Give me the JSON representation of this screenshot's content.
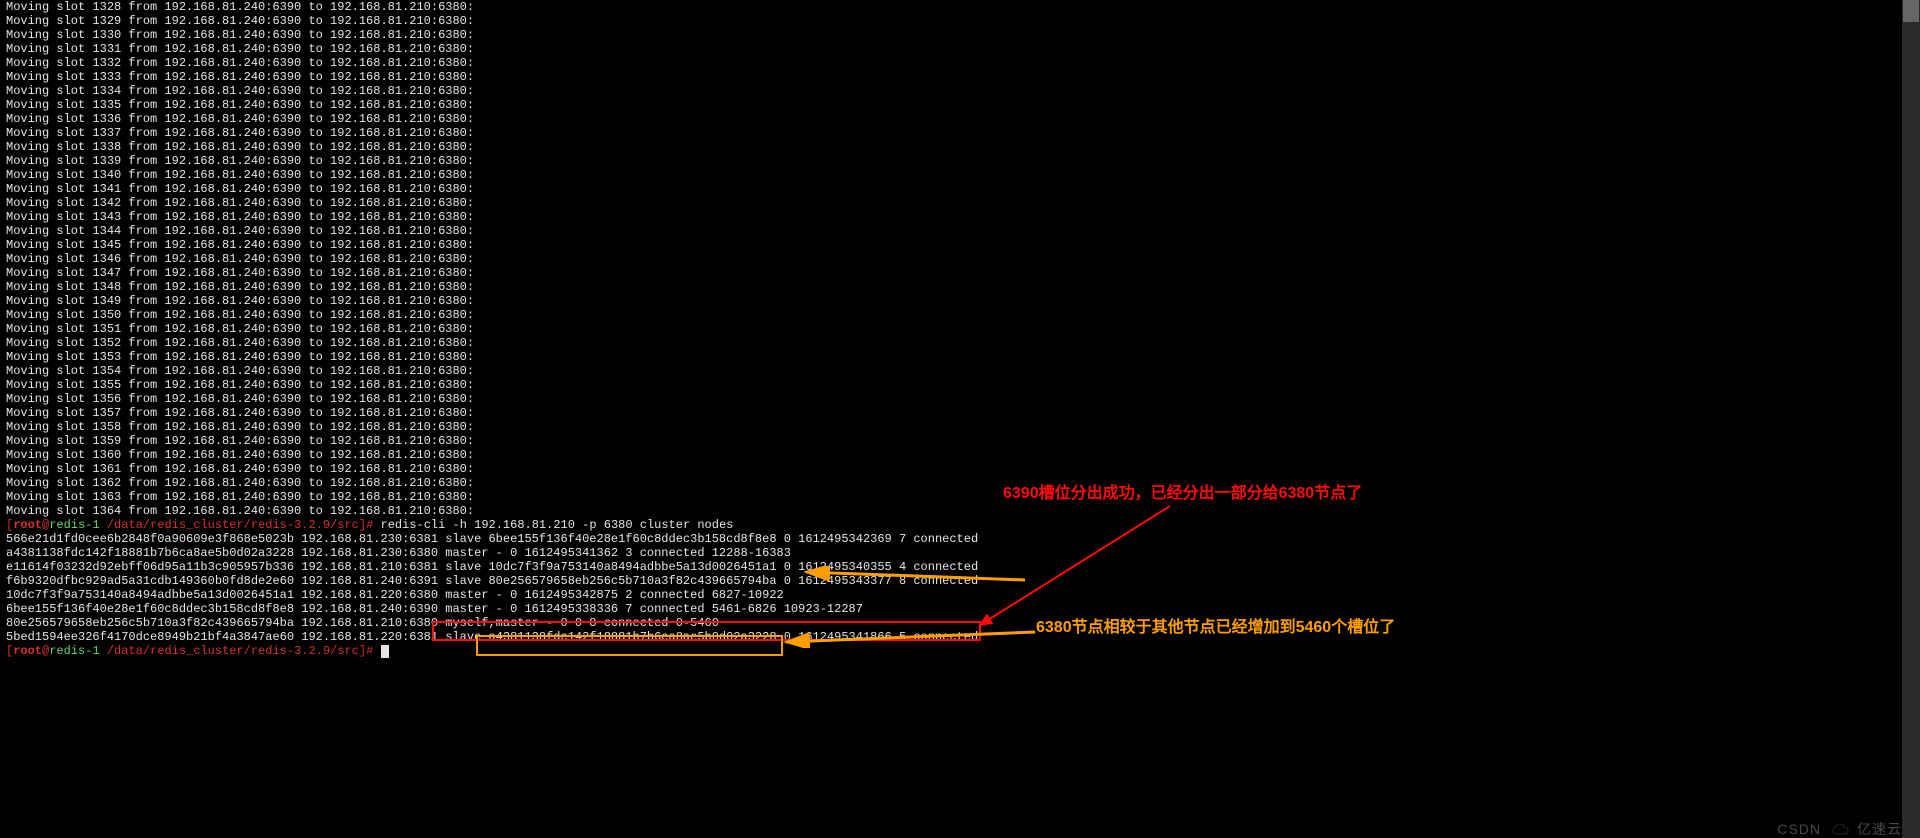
{
  "slot_start": 1328,
  "slot_end": 1364,
  "move_template": {
    "from_ip": "192.168.81.240",
    "from_port": "6390",
    "to_ip": "192.168.81.210",
    "to_port": "6380"
  },
  "prompt1": {
    "user": "root",
    "host": "redis-1",
    "path": "/data/redis_cluster/redis-3.2.9/src",
    "cmd": "redis-cli -h 192.168.81.210 -p 6380 cluster nodes"
  },
  "cluster_nodes": [
    "566e21d1fd0cee6b2848f0a90609e3f868e5023b 192.168.81.230:6381 slave 6bee155f136f40e28e1f60c8ddec3b158cd8f8e8 0 1612495342369 7 connected",
    "a4381138fdc142f18881b7b6ca8ae5b0d02a3228 192.168.81.230:6380 master - 0 1612495341362 3 connected 12288-16383",
    "e11614f03232d92ebff06d95a11b3c905957b336 192.168.81.210:6381 slave 10dc7f3f9a753140a8494adbbe5a13d0026451a1 0 1612495340355 4 connected",
    "f6b9320dfbc929ad5a31cdb149360b0fd8de2e60 192.168.81.240:6391 slave 80e256579658eb256c5b710a3f82c439665794ba 0 1612495343377 8 connected",
    "10dc7f3f9a753140a8494adbbe5a13d0026451a1 192.168.81.220:6380 master - 0 1612495342875 2 connected 6827-10922",
    "6bee155f136f40e28e1f60c8ddec3b158cd8f8e8 192.168.81.240:6390 master - 0 1612495338336 7 connected 5461-6826 10923-12287",
    "80e256579658eb256c5b710a3f82c439665794ba 192.168.81.210:6380 myself,master - 0 0 8 connected 0-5460",
    "5bed1594ee326f4170dce8949b21bf4a3847ae60 192.168.81.220:6381 slave a4381138fdc142f18881b7b6ca8ae5b0d02a3228 0 1612495341866 5 connected"
  ],
  "prompt2": {
    "user": "root",
    "host": "redis-1",
    "path": "/data/redis_cluster/redis-3.2.9/src",
    "cmd": ""
  },
  "annotations": {
    "red": "6390槽位分出成功，已经分出一部分给6380节点了",
    "yellow": "6380节点相较于其他节点已经增加到5460个槽位了"
  },
  "watermarks": {
    "csdn": "CSDN",
    "yisu": "亿速云"
  }
}
